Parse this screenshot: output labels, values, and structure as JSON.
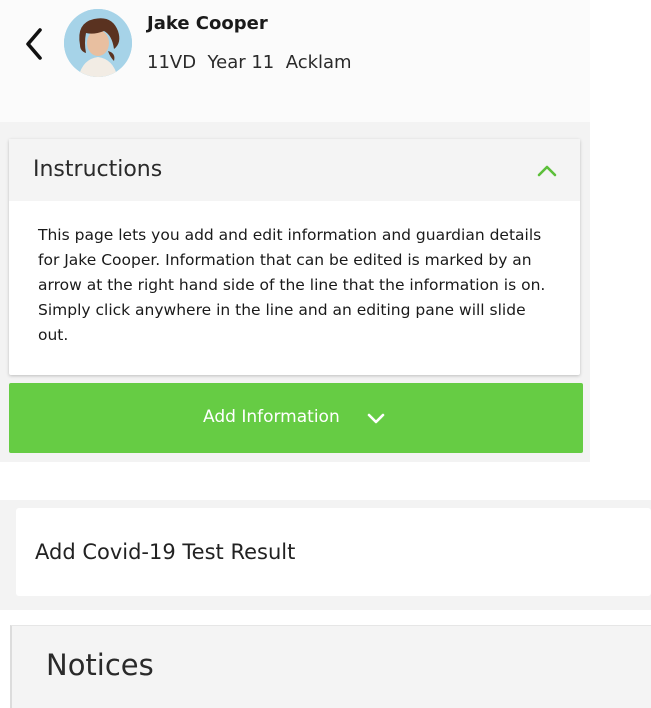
{
  "header": {
    "back_icon": "chevron-left-icon",
    "student_name": "Jake Cooper",
    "student_meta": "11VD  Year 11  Acklam"
  },
  "instructions": {
    "title": "Instructions",
    "toggle_icon": "chevron-up-icon",
    "body": "This page lets you add and edit information and guardian details for Jake Cooper. Information that can be edited is marked by an arrow at the right hand side of the line that the information is on. Simply click anywhere in the line and an editing pane will slide out."
  },
  "add_information": {
    "label": "Add Information",
    "icon": "chevron-down-icon"
  },
  "covid": {
    "label": "Add Covid-19 Test Result"
  },
  "notices": {
    "title": "Notices"
  },
  "colors": {
    "accent_green": "#66cc44",
    "chevron_green": "#5cbf3a"
  }
}
